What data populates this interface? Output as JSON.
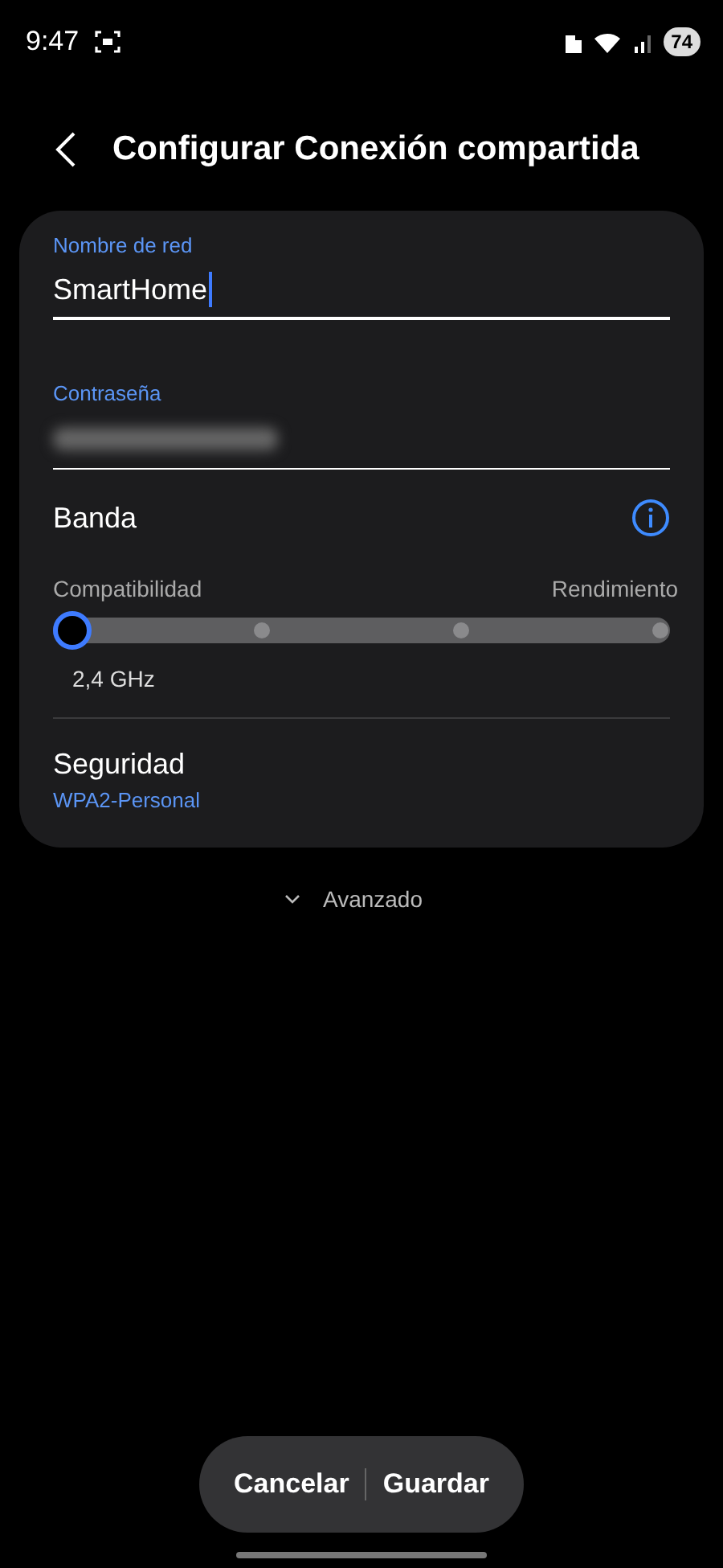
{
  "status_bar": {
    "time": "9:47",
    "battery": "74"
  },
  "header": {
    "title": "Configurar Conexión compartida"
  },
  "network_name": {
    "label": "Nombre de red",
    "value": "SmartHome",
    "focused": true
  },
  "password": {
    "label": "Contraseña",
    "blurred": true
  },
  "band": {
    "title": "Banda",
    "left_label": "Compatibilidad",
    "right_label": "Rendimiento",
    "level": 0,
    "reading": "2,4 GHz"
  },
  "security": {
    "title": "Seguridad",
    "value": "WPA2-Personal"
  },
  "advanced": {
    "label": "Avanzado",
    "expanded": false
  },
  "buttons": [
    {
      "label": "Cancelar"
    },
    {
      "label": "Guardar"
    }
  ]
}
